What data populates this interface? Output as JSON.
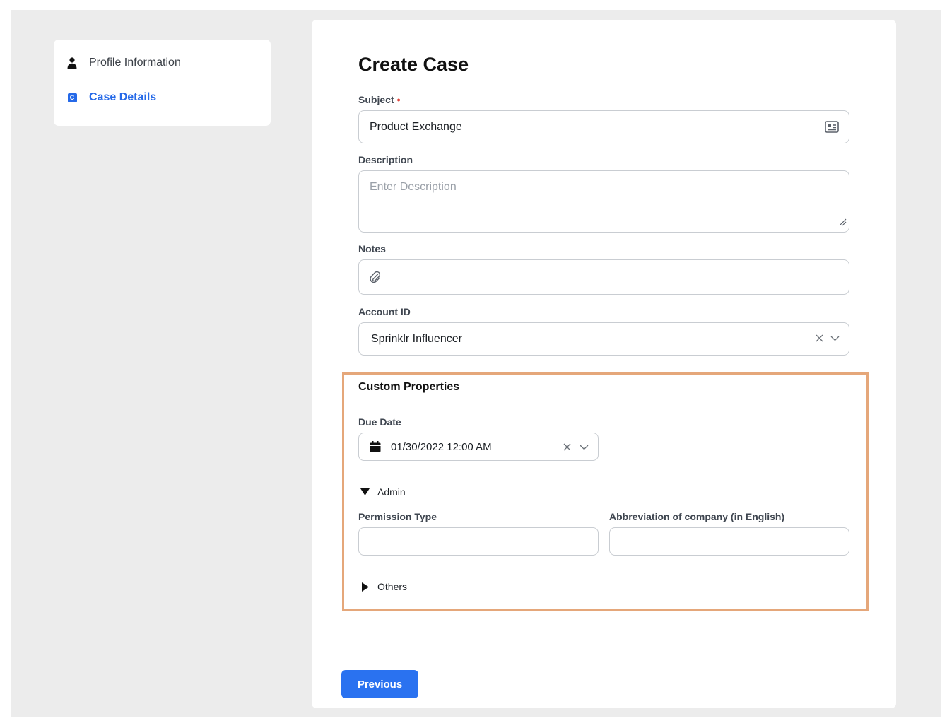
{
  "sidebar": {
    "items": [
      {
        "label": "Profile Information",
        "icon": "person-icon",
        "active": false
      },
      {
        "label": "Case Details",
        "icon": "c-badge-icon",
        "badge": "C",
        "active": true
      }
    ]
  },
  "form": {
    "title": "Create Case",
    "subject": {
      "label": "Subject",
      "required_mark": "•",
      "value": "Product Exchange"
    },
    "description": {
      "label": "Description",
      "placeholder": "Enter Description",
      "value": ""
    },
    "notes": {
      "label": "Notes",
      "value": ""
    },
    "account_id": {
      "label": "Account ID",
      "value": "Sprinklr Influencer"
    },
    "custom_properties": {
      "title": "Custom Properties",
      "due_date": {
        "label": "Due Date",
        "value": "01/30/2022 12:00 AM"
      },
      "admin": {
        "label": "Admin",
        "expanded": true,
        "permission_type": {
          "label": "Permission Type",
          "value": ""
        },
        "abbreviation": {
          "label": "Abbreviation of company (in English)",
          "value": ""
        }
      },
      "others": {
        "label": "Others",
        "expanded": false
      }
    }
  },
  "footer": {
    "previous_label": "Previous"
  },
  "colors": {
    "accent": "#2a72f0",
    "active_step": "#2569e8",
    "required": "#e0443a",
    "highlight_border": "#e5a77a",
    "background": "#ececec"
  }
}
